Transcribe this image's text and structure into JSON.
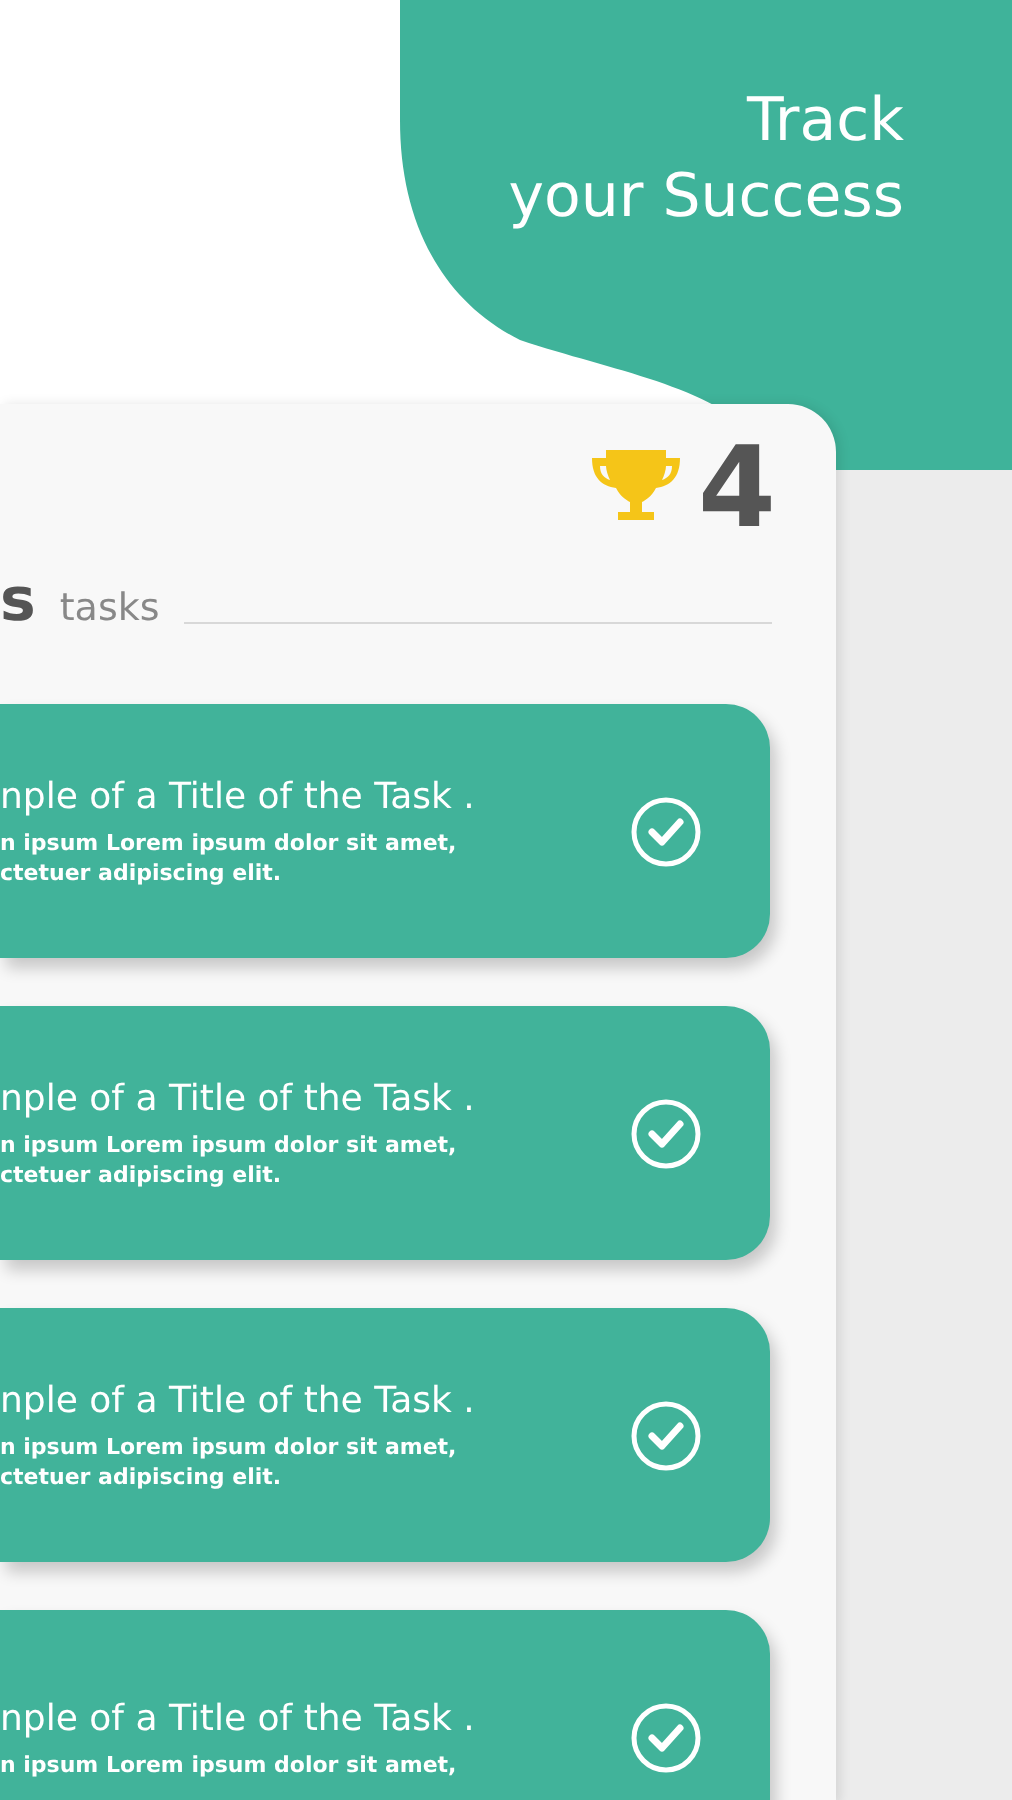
{
  "headline": [
    "Track",
    "your Success"
  ],
  "trophy_count": "4",
  "section": {
    "title": "s",
    "subtitle": "tasks"
  },
  "tasks": [
    {
      "title": "nple of a Title of the Task .",
      "lines": [
        "n ipsum Lorem ipsum dolor sit amet,",
        "ctetuer adipiscing elit."
      ],
      "checked": true
    },
    {
      "title": "nple of a Title of the Task .",
      "lines": [
        "n ipsum Lorem ipsum dolor sit amet,",
        "ctetuer adipiscing elit."
      ],
      "checked": true
    },
    {
      "title": "nple of a Title of the Task .",
      "lines": [
        "n ipsum Lorem ipsum dolor sit amet,",
        "ctetuer adipiscing elit."
      ],
      "checked": true
    },
    {
      "title": "nple of a Title of the Task .",
      "lines": [
        "n ipsum Lorem ipsum dolor sit amet,"
      ],
      "checked": true
    }
  ]
}
